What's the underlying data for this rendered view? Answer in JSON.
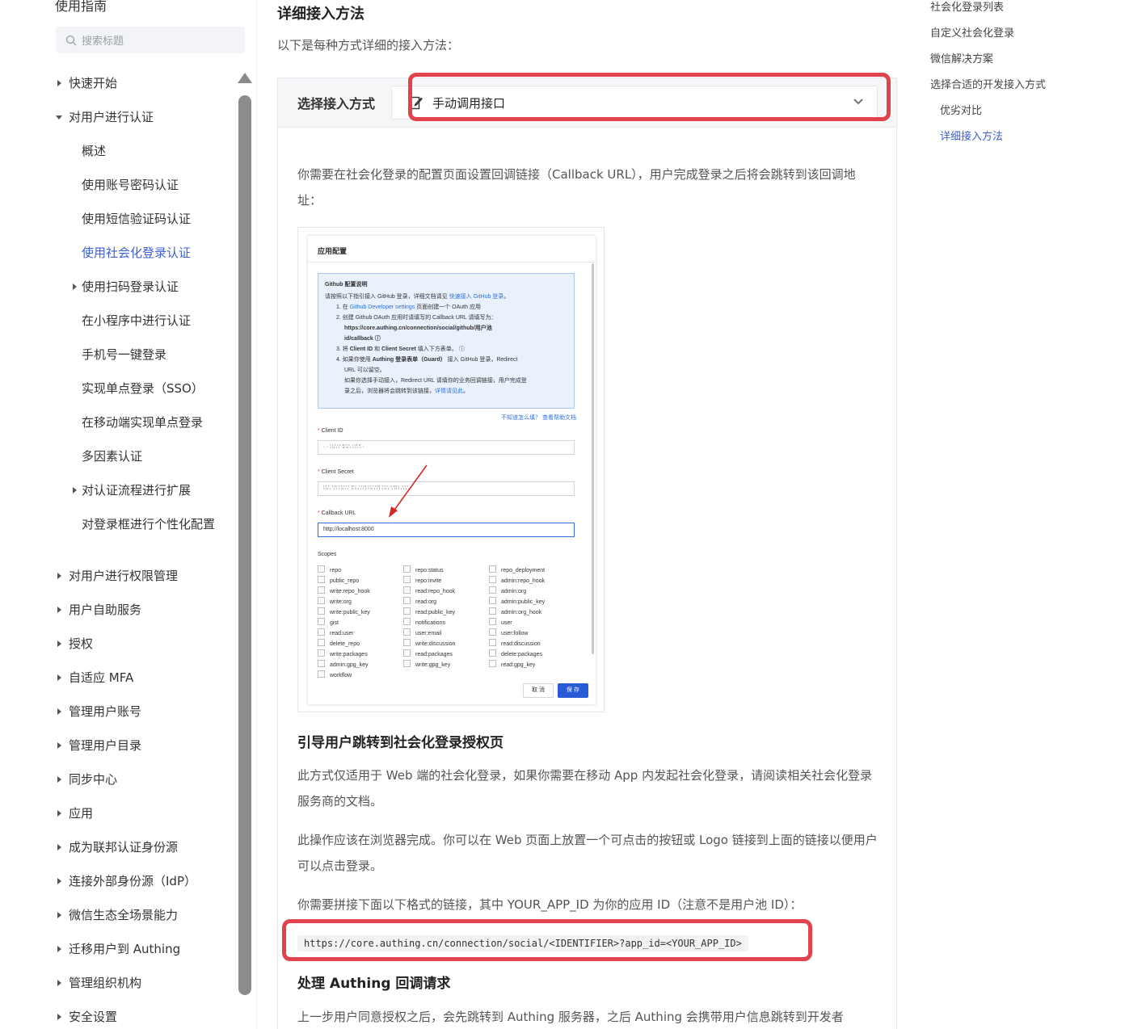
{
  "sidebar": {
    "title": "使用指南",
    "search_placeholder": "搜索标题",
    "items": [
      {
        "label": "快速开始"
      },
      {
        "label": "对用户进行认证"
      },
      {
        "label": "概述"
      },
      {
        "label": "使用账号密码认证"
      },
      {
        "label": "使用短信验证码认证"
      },
      {
        "label": "使用社会化登录认证"
      },
      {
        "label": "使用扫码登录认证"
      },
      {
        "label": "在小程序中进行认证"
      },
      {
        "label": "手机号一键登录"
      },
      {
        "label": "实现单点登录（SSO）"
      },
      {
        "label": "在移动端实现单点登录"
      },
      {
        "label": "多因素认证"
      },
      {
        "label": "对认证流程进行扩展"
      },
      {
        "label": "对登录框进行个性化配置"
      },
      {
        "label": "对用户进行权限管理"
      },
      {
        "label": "用户自助服务"
      },
      {
        "label": "授权"
      },
      {
        "label": "自适应 MFA"
      },
      {
        "label": "管理用户账号"
      },
      {
        "label": "管理用户目录"
      },
      {
        "label": "同步中心"
      },
      {
        "label": "应用"
      },
      {
        "label": "成为联邦认证身份源"
      },
      {
        "label": "连接外部身份源（IdP）"
      },
      {
        "label": "微信生态全场景能力"
      },
      {
        "label": "迁移用户到 Authing"
      },
      {
        "label": "管理组织机构"
      },
      {
        "label": "安全设置"
      }
    ]
  },
  "main": {
    "heading": "详细接入方法",
    "intro": "以下是每种方式详细的接入方法：",
    "selector_label": "选择接入方式",
    "selector_value": "手动调用接口",
    "callback_para": "你需要在社会化登录的配置页面设置回调链接（Callback URL），用户完成登录之后将会跳转到该回调地址：",
    "h_redirect": "引导用户跳转到社会化登录授权页",
    "para_web_only": "此方式仅适用于 Web 端的社会化登录，如果你需要在移动 App 内发起社会化登录，请阅读相关社会化登录服务商的文档。",
    "para_browser": "此操作应该在浏览器完成。你可以在 Web 页面上放置一个可点击的按钮或 Logo 链接到上面的链接以便用户可以点击登录。",
    "para_format": "你需要拼接下面以下格式的链接，其中 YOUR_APP_ID 为你的应用 ID（注意不是用户池 ID）：",
    "code_url": "https://core.authing.cn/connection/social/<IDENTIFIER>?app_id=<YOUR_APP_ID>",
    "h_callback": "处理 Authing 回调请求",
    "para_after": "上一步用户同意授权之后，会先跳转到 Authing 服务器，之后 Authing 会携带用户信息跳转到开发者"
  },
  "screenshot": {
    "title": "应用配置",
    "note_title": "Github 配置说明",
    "note_l1a": "请按照以下指引接入 GitHub 登录，详细文档请见 ",
    "note_l1_link": "快速接入 GitHub 登录",
    "note_l1b": "。",
    "note_l2a": "1. 在 ",
    "note_l2_link": "Github Developer settings",
    "note_l2b": " 页面创建一个 OAuth 应用",
    "note_l3": "2. 创建 Github OAuth 应用时请填写的 Callback URL 请填写为：",
    "note_l4": "https://core.authing.cn/connection/social/github/用户池",
    "note_l5": "id/callback ⓘ",
    "note_l6a": "3. 将 ",
    "note_l6_b1": "Client ID",
    "note_l6_mid": " 和 ",
    "note_l6_b2": "Client Secret",
    "note_l6b": " 填入下方表单。 ⓘ",
    "note_l7a": "4. 如果你使用 ",
    "note_l7_b": "Authing 登录表单（Guard）",
    "note_l7b": " 接入 GitHub 登录，Redirect",
    "note_l8": "URL 可以留空。",
    "note_l9": "如果你选择手动接入，Redirect URL 请填你的业务回调链接，用户完成登",
    "note_l10a": "录之后，浏览器将会跳转到该链接，",
    "note_l10_link": "详情请见此",
    "note_l10b": "。",
    "help_link": "不知道怎么填？ 查看帮助文档",
    "client_id_label": "Client ID",
    "client_id_value": "· ∙ ∷∴∵ ∶∷∴ ∷∵∶ ∙",
    "client_secret_label": "Client Secret",
    "client_secret_value": "∷∴ ∵∶ ∷∴∵ ∶∷ ∴∵∶ ∷∴∵∶ ∷∴ ∵∶∷ ∴∵",
    "callback_label": "Callback URL",
    "callback_value": "http://localhost:8000",
    "scopes_label": "Scopes",
    "scopes_col1": [
      "repo",
      "public_repo",
      "write:repo_hook",
      "write:org",
      "write:public_key",
      "gist",
      "read:user",
      "delete_repo",
      "write:packages",
      "admin:gpg_key",
      "workflow"
    ],
    "scopes_col2": [
      "repo:status",
      "repo:invite",
      "read:repo_hook",
      "read:org",
      "read:public_key",
      "notifications",
      "user:email",
      "write:discussion",
      "read:packages",
      "write:gpg_key"
    ],
    "scopes_col3": [
      "repo_deployment",
      "admin:repo_hook",
      "admin:org",
      "admin:public_key",
      "admin:org_hook",
      "user",
      "user:follow",
      "read:discussion",
      "delete:packages",
      "read:gpg_key"
    ],
    "cancel": "取 消",
    "save": "保 存"
  },
  "toc": {
    "items": [
      {
        "label": "社会化登录列表"
      },
      {
        "label": "自定义社会化登录"
      },
      {
        "label": "微信解决方案"
      },
      {
        "label": "选择合适的开发接入方式"
      },
      {
        "label": "优劣对比"
      },
      {
        "label": "详细接入方法"
      }
    ]
  },
  "colors": {
    "accent": "#3d5fcf",
    "highlight_box": "#e0434a"
  }
}
